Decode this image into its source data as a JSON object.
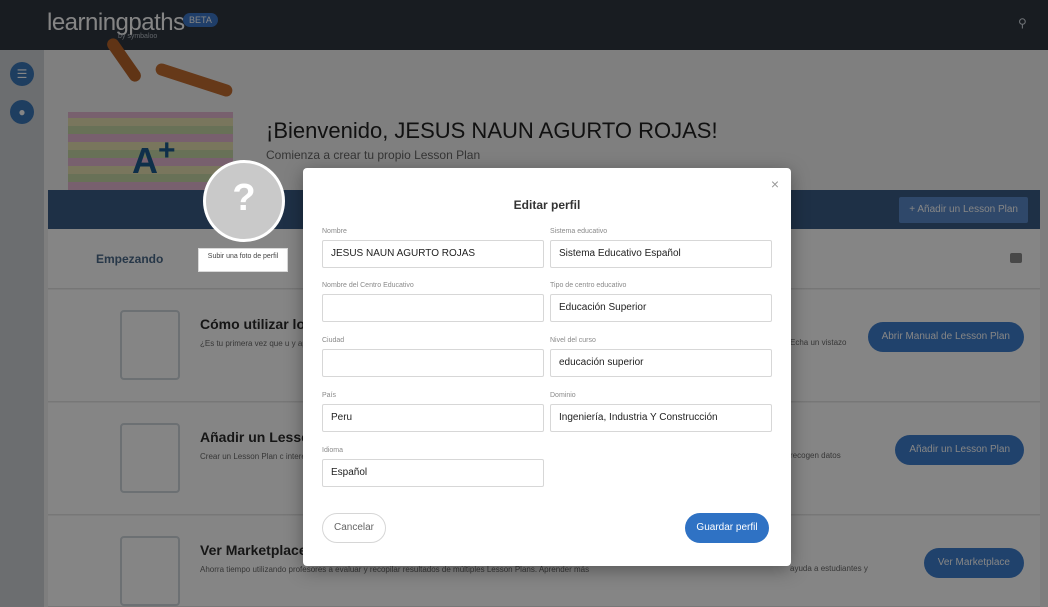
{
  "app": {
    "logo_text": "learningpaths",
    "logo_sub": "by symbaloo",
    "beta_label": "BETA"
  },
  "hero": {
    "title": "¡Bienvenido, JESUS NAUN AGURTO ROJAS!",
    "subtitle": "Comienza a crear tu propio Lesson Plan",
    "add_button": "+ Añadir un Lesson Plan"
  },
  "section": {
    "title": "Empezando"
  },
  "cards": [
    {
      "title": "Cómo utilizar los L",
      "desc": "¿Es tu primera vez que u y aprende las funcional",
      "side": "Echa un vistazo",
      "button": "Abrir Manual de Lesson Plan"
    },
    {
      "title": "Añadir un Lesson P",
      "desc": "Crear un Lesson Plan c interesantes y mejorar l",
      "side": "recogen datos",
      "button": "Añadir un Lesson Plan"
    },
    {
      "title": "Ver Marketplace",
      "desc": "Ahorra tiempo utilizando profesores a evaluar y recopilar resultados de múltiples Lesson Plans. Aprender más",
      "side": "ayuda a estudiantes y",
      "button": "Ver Marketplace"
    }
  ],
  "avatar": {
    "tooltip": "Subir una foto de perfil"
  },
  "modal": {
    "title": "Editar perfil",
    "close": "×",
    "fields": {
      "nombre": {
        "label": "Nombre",
        "value": "JESUS NAUN AGURTO ROJAS"
      },
      "sistema": {
        "label": "Sistema educativo",
        "value": "Sistema Educativo Español"
      },
      "centro": {
        "label": "Nombre del Centro Educativo",
        "value": ""
      },
      "tipo": {
        "label": "Tipo de centro educativo",
        "value": "Educación Superior"
      },
      "ciudad": {
        "label": "Ciudad",
        "value": ""
      },
      "nivel": {
        "label": "Nivel del curso",
        "value": "educación superior"
      },
      "pais": {
        "label": "País",
        "value": "Peru"
      },
      "dominio": {
        "label": "Dominio",
        "value": "Ingeniería, Industria Y Construcción"
      },
      "idioma": {
        "label": "Idioma",
        "value": "Español"
      }
    },
    "cancel_label": "Cancelar",
    "save_label": "Guardar perfil"
  }
}
